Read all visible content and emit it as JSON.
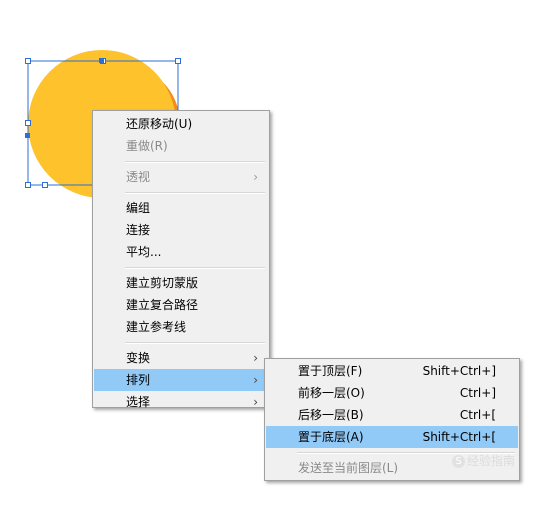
{
  "context_menu": {
    "groups": [
      [
        {
          "label": "还原移动(U)",
          "disabled": false
        },
        {
          "label": "重做(R)",
          "disabled": true
        }
      ],
      [
        {
          "label": "透视",
          "disabled": true,
          "submenu": true
        }
      ],
      [
        {
          "label": "编组",
          "disabled": false
        },
        {
          "label": "连接",
          "disabled": false
        },
        {
          "label": "平均...",
          "disabled": false
        }
      ],
      [
        {
          "label": "建立剪切蒙版",
          "disabled": false
        },
        {
          "label": "建立复合路径",
          "disabled": false
        },
        {
          "label": "建立参考线",
          "disabled": false
        }
      ],
      [
        {
          "label": "变换",
          "disabled": false,
          "submenu": true
        },
        {
          "label": "排列",
          "disabled": false,
          "submenu": true,
          "highlighted": true
        },
        {
          "label": "选择",
          "disabled": false,
          "submenu": true
        }
      ]
    ],
    "submenu_arrow": "›"
  },
  "arrange_submenu": {
    "groups": [
      [
        {
          "label": "置于顶层(F)",
          "shortcut": "Shift+Ctrl+]",
          "disabled": false
        },
        {
          "label": "前移一层(O)",
          "shortcut": "Ctrl+]",
          "disabled": false
        },
        {
          "label": "后移一层(B)",
          "shortcut": "Ctrl+[",
          "disabled": false
        },
        {
          "label": "置于底层(A)",
          "shortcut": "Shift+Ctrl+[",
          "disabled": false,
          "highlighted": true
        }
      ],
      [
        {
          "label": "发送至当前图层(L)",
          "shortcut": "",
          "disabled": true
        }
      ]
    ]
  },
  "artwork": {
    "front_circle_color": "#fdc22c",
    "back_circle_color": "#f28c1a",
    "selection_color": "#2d6fd6"
  },
  "watermark": {
    "symbol": "S",
    "text": "经验指南"
  }
}
